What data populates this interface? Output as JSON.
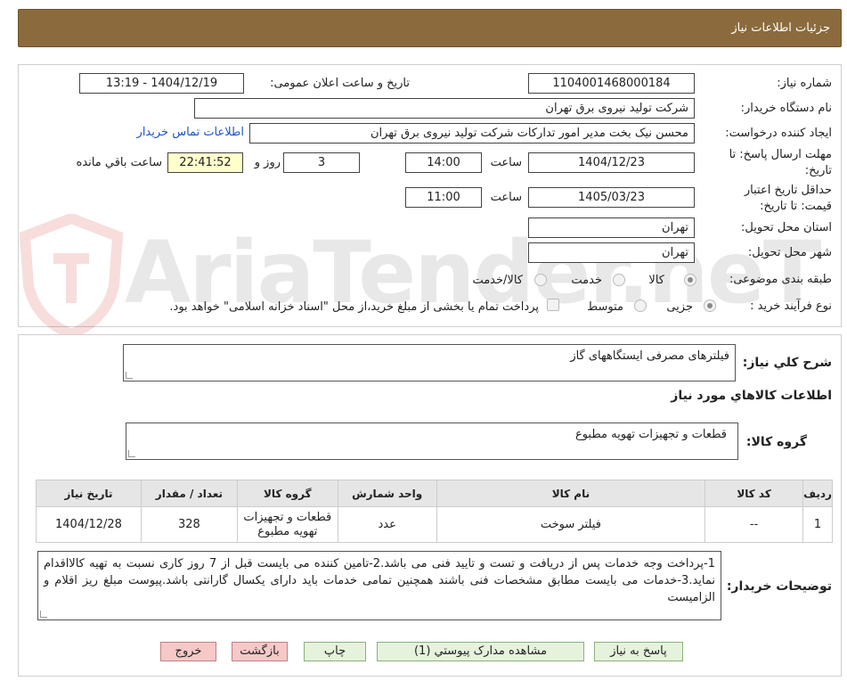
{
  "header": {
    "title": "جزئیات اطلاعات نیاز"
  },
  "watermark": {
    "text": "AriaTender.neT"
  },
  "form": {
    "need_number_label": "شماره نیاز:",
    "need_number": "1104001468000184",
    "announce_label": "تاریخ و ساعت اعلان عمومی:",
    "announce_value": "1404/12/19 - 13:19",
    "buyer_label": "نام دستگاه خریدار:",
    "buyer_value": "شرکت تولید نیروی برق تهران",
    "creator_label": "ایجاد کننده درخواست:",
    "creator_value": "محسن نیک بخت مدیر امور تدارکات شرکت تولید نیروی برق تهران",
    "contact_link": "اطلاعات تماس خریدار",
    "deadline_label_1": "مهلت ارسال پاسخ: تا",
    "deadline_label_2": "تاریخ:",
    "deadline_date": "1404/12/23",
    "time_label": "ساعت",
    "deadline_time": "14:00",
    "days_value": "3",
    "days_label": "روز و",
    "remaining_time": "22:41:52",
    "remaining_label": "ساعت باقي مانده",
    "validity_label_1": "حداقل تاریخ اعتبار",
    "validity_label_2": "قیمت: تا تاریخ:",
    "validity_date": "1405/03/23",
    "validity_time": "11:00",
    "province_label": "استان محل تحویل:",
    "province_value": "تهران",
    "city_label": "شهر محل تحویل:",
    "city_value": "تهران",
    "category_label": "طبقه بندی موضوعی:",
    "category_options": [
      "کالا",
      "خدمت",
      "کالا/خدمت"
    ],
    "process_label": "نوع فرآیند خرید :",
    "process_options": [
      "جزیی",
      "متوسط"
    ],
    "payment_note": "پرداخت تمام یا بخشی از مبلغ خرید،از محل \"اسناد خزانه اسلامی\" خواهد بود."
  },
  "details": {
    "summary_label": "شرح كلي نياز:",
    "summary_value": "فیلترهای مصرفی ایستگاههای گاز",
    "goods_info_title": "اطلاعات كالاهاي مورد نياز",
    "goods_group_label": "گروه كالا:",
    "goods_group_value": "قطعات و تجهیزات تهویه مطبوع"
  },
  "table": {
    "headers": [
      "رديف",
      "كد كالا",
      "نام كالا",
      "واحد شمارش",
      "گروه كالا",
      "تعداد / مقدار",
      "تاريخ نياز"
    ],
    "rows": [
      [
        "1",
        "--",
        "فیلتر سوخت",
        "عدد",
        "قطعات و تجهیزات تهویه مطبوع",
        "328",
        "1404/12/28"
      ]
    ]
  },
  "buyer_notes": {
    "label": "توضیحات خریدار:",
    "text": "1-پرداخت وجه خدمات پس از دریافت و تست و تایید فنی می باشد.2-تامین کننده می بایست قبل از 7 روز کاری نسبت به تهیه کالااقدام نماید.3-خدمات می بایست مطابق مشخصات فنی باشند همچنین تمامی خدمات باید دارای یکسال گارانتی باشد.پیوست مبلغ ریز اقلام و الزامیست"
  },
  "buttons": {
    "reply": "پاسخ به نیاز",
    "attachments": "مشاهده مدارک پیوستي (1)",
    "print": "چاپ",
    "back": "بازگشت",
    "exit": "خروج"
  }
}
